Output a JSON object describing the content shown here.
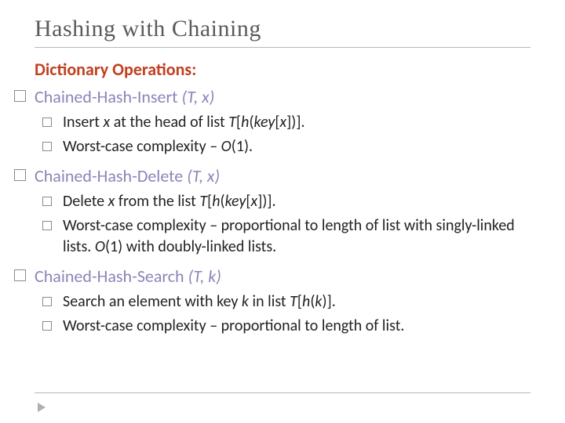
{
  "slide": {
    "title": "Hashing with Chaining",
    "subheading": "Dictionary Operations:",
    "ops": [
      {
        "name": "Chained-Hash-Insert",
        "args": "(T, x)",
        "lines": [
          "Insert <span class=\"i\">x</span> at the head of list <span class=\"i\">T</span>[<span class=\"i\">h</span>(<span class=\"i\">key</span>[<span class=\"i\">x</span>])].",
          "Worst-case complexity – <span class=\"i\">O</span>(1)."
        ]
      },
      {
        "name": "Chained-Hash-Delete",
        "args": "(T, x)",
        "lines": [
          "Delete <span class=\"i\">x</span> from the list <span class=\"i\">T</span>[<span class=\"i\">h</span>(<span class=\"i\">key</span>[<span class=\"i\">x</span>])].",
          "Worst-case complexity – proportional to length of list with singly-linked lists. <span class=\"i\">O</span>(1) with doubly-linked lists."
        ]
      },
      {
        "name": "Chained-Hash-Search",
        "args": "(T, k)",
        "lines": [
          "Search an element with key <span class=\"i\">k</span> in list <span class=\"i\">T</span>[<span class=\"i\">h</span>(<span class=\"i\">k</span>)].",
          "Worst-case complexity – proportional to length of list."
        ]
      }
    ]
  }
}
